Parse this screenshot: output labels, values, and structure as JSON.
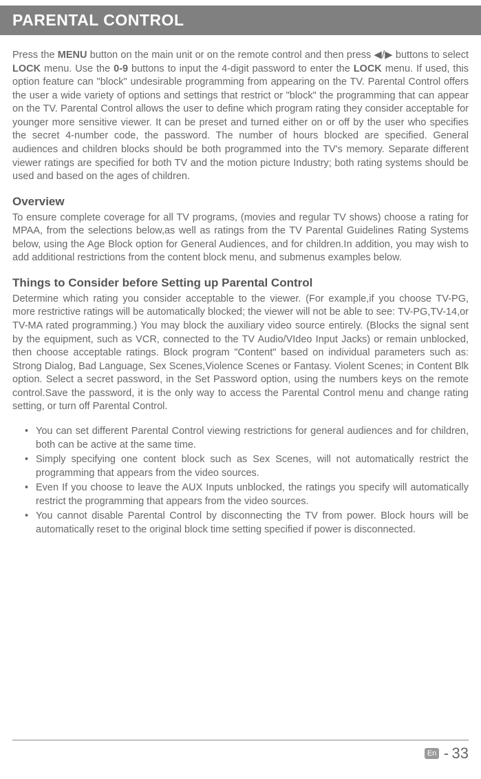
{
  "header": {
    "title": "PARENTAL CONTROL"
  },
  "intro": {
    "html": "Press the <b>MENU</b> button on the main unit or on the remote control and then press ◀/▶ buttons to select <b>LOCK</b> menu. Use the <b>0-9</b> buttons to input the 4-digit password to enter the <b>LOCK</b> menu. If used, this option feature  can \"block\" undesirable programming from appearing on the TV. Parental Control offers the user a wide  variety  of options and settings that restrict or \"block\" the programming that can appear on the TV. Parental Control allows the user to define which program rating they consider acceptable for younger more sensitive viewer. It can be preset and turned either on or off by the user who specifies the secret 4-number code, the password. The number of hours blocked are specified. General audiences and children blocks should be both programmed into the TV's memory. Separate different viewer ratings are specified for both TV and the motion picture Industry;  both rating systems should be used and based on the ages of children."
  },
  "overview": {
    "heading": "Overview",
    "text": "To ensure complete coverage for all TV programs, (movies and regular TV shows) choose a rating for MPAA, from the selections below,as well as ratings from the TV Parental Guidelines Rating Systems below, using the Age Block option for General Audiences, and for children.In addition, you may wish to add additional restrictions from the content block menu, and submenus examples below."
  },
  "consider": {
    "heading": "Things to Consider before Setting up Parental Control",
    "text": "Determine which rating you consider acceptable to the viewer. (For example,if you choose TV-PG, more restrictive ratings will be automatically blocked; the viewer will not be able to see: TV-PG,TV-14,or TV-MA rated programming.) You may block the auxiliary video source entirely. (Blocks the signal sent by the equipment, such as VCR, connected to the TV Audio/VIdeo Input Jacks) or remain unblocked, then choose acceptable ratings. Block program \"Content\" based on individual parameters such as: Strong Dialog, Bad Language, Sex Scenes,Violence Scenes or Fantasy. Violent Scenes; in Content Blk option. Select a secret password, in the Set Password option, using the numbers keys on the remote control.Save the password, it is the only way to access the Parental  Control menu and change rating setting, or turn off Parental Control."
  },
  "bullets": [
    "You can set different Parental Control viewing restrictions for general audiences and for children, both can be active at the same time.",
    "Simply specifying one content block such as Sex Scenes, will not automatically restrict the programming that appears from the video sources.",
    "Even If you choose to leave the AUX Inputs unblocked, the ratings you specify will automatically restrict the programming that appears from the video sources.",
    "You cannot disable Parental Control by disconnecting the TV from power. Block hours will be automatically reset to the original block time setting specified if power is disconnected."
  ],
  "footer": {
    "lang": "En",
    "dash": "-",
    "page": "33"
  }
}
